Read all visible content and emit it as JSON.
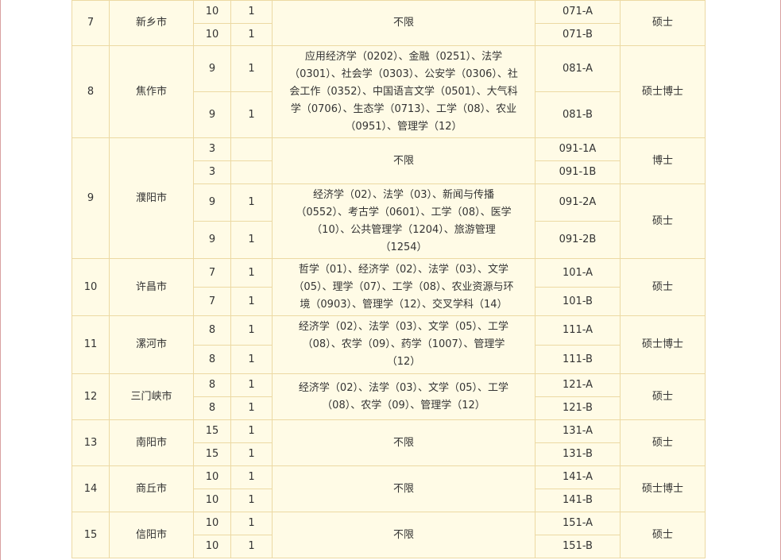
{
  "rows": [
    {
      "no": "7",
      "city": "新乡市",
      "sub": [
        {
          "count": "10",
          "n": "1",
          "code": "071-A"
        },
        {
          "count": "10",
          "n": "1",
          "code": "071-B"
        }
      ],
      "major": [
        "不限"
      ],
      "degree": "硕士"
    },
    {
      "no": "8",
      "city": "焦作市",
      "sub": [
        {
          "count": "9",
          "n": "1",
          "code": "081-A"
        },
        {
          "count": "9",
          "n": "1",
          "code": "081-B"
        }
      ],
      "major": [
        "应用经济学（0202）、金融（0251）、法学",
        "（0301）、社会学（0303）、公安学（0306）、社",
        "会工作（0352）、中国语言文学（0501）、大气科",
        "学（0706）、生态学（0713）、工学（08）、农业",
        "（0951）、管理学（12）"
      ],
      "degree": "硕士博士"
    },
    {
      "no": "9",
      "city": "濮阳市",
      "sub_a": [
        {
          "count": "3",
          "n": "",
          "code": "091-1A"
        },
        {
          "count": "3",
          "n": "",
          "code": "091-1B"
        }
      ],
      "major_a": [
        "不限"
      ],
      "degree_a": "博士",
      "sub_b": [
        {
          "count": "9",
          "n": "1",
          "code": "091-2A"
        },
        {
          "count": "9",
          "n": "1",
          "code": "091-2B"
        }
      ],
      "major_b": [
        "经济学（02）、法学（03）、新闻与传播",
        "（0552）、考古学（0601）、工学（08）、医学",
        "（10）、公共管理学（1204）、旅游管理",
        "（1254）"
      ],
      "degree_b": "硕士"
    },
    {
      "no": "10",
      "city": "许昌市",
      "sub": [
        {
          "count": "7",
          "n": "1",
          "code": "101-A"
        },
        {
          "count": "7",
          "n": "1",
          "code": "101-B"
        }
      ],
      "major": [
        "哲学（01）、经济学（02）、法学（03）、文学",
        "（05）、理学（07）、工学（08）、农业资源与环",
        "境（0903）、管理学（12）、交叉学科（14）"
      ],
      "degree": "硕士"
    },
    {
      "no": "11",
      "city": "漯河市",
      "sub": [
        {
          "count": "8",
          "n": "1",
          "code": "111-A"
        },
        {
          "count": "8",
          "n": "1",
          "code": "111-B"
        }
      ],
      "major": [
        "经济学（02）、法学（03）、文学（05）、工学",
        "（08）、农学（09）、药学（1007）、管理学",
        "（12）"
      ],
      "degree": "硕士博士"
    },
    {
      "no": "12",
      "city": "三门峡市",
      "sub": [
        {
          "count": "8",
          "n": "1",
          "code": "121-A"
        },
        {
          "count": "8",
          "n": "1",
          "code": "121-B"
        }
      ],
      "major": [
        "经济学（02）、法学（03）、文学（05）、工学",
        "（08）、农学（09）、管理学（12）"
      ],
      "degree": "硕士"
    },
    {
      "no": "13",
      "city": "南阳市",
      "sub": [
        {
          "count": "15",
          "n": "1",
          "code": "131-A"
        },
        {
          "count": "15",
          "n": "1",
          "code": "131-B"
        }
      ],
      "major": [
        "不限"
      ],
      "degree": "硕士"
    },
    {
      "no": "14",
      "city": "商丘市",
      "sub": [
        {
          "count": "10",
          "n": "1",
          "code": "141-A"
        },
        {
          "count": "10",
          "n": "1",
          "code": "141-B"
        }
      ],
      "major": [
        "不限"
      ],
      "degree": "硕士博士"
    },
    {
      "no": "15",
      "city": "信阳市",
      "sub": [
        {
          "count": "10",
          "n": "1",
          "code": "151-A"
        },
        {
          "count": "10",
          "n": "1",
          "code": "151-B"
        }
      ],
      "major": [
        "不限"
      ],
      "degree": "硕士"
    }
  ]
}
